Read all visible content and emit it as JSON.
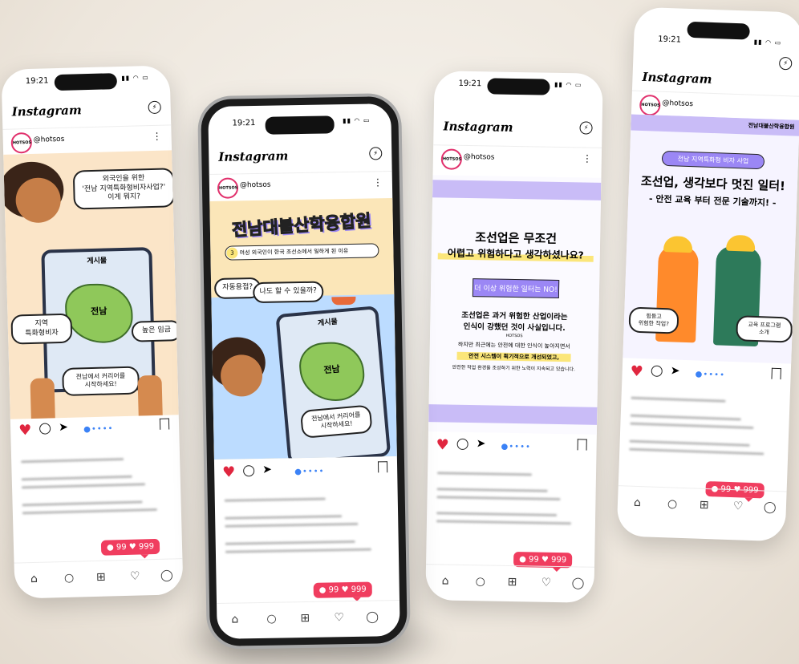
{
  "phones": [
    {
      "time": "19:21",
      "app": "Instagram",
      "handle": "@hotsos",
      "avatar": "HOTSOS",
      "post": {
        "bubble": "외국인을 위한\n'전남 지역특화형비자사업?'\n이게 뭐지?",
        "map_label": "전남",
        "screen_title": "게시물",
        "left_tag": "지역\n특화형비자",
        "right_tag": "높은 임금",
        "bottom_note": "전남에서 커리어를\n시작하세요!"
      },
      "badge": "● 99 ♥ 999"
    },
    {
      "time": "19:21",
      "app": "Instagram",
      "handle": "@hotsos",
      "avatar": "HOTSOS",
      "post": {
        "title": "전남대불산학융합원",
        "subtitle_num": "3",
        "subtitle": "여성 외국인이 한국 조선소에서 일하게 된 이유",
        "thought1": "자동용접?",
        "thought2": "나도 할 수 있을까?",
        "screen_title": "게시물",
        "map_label": "전남",
        "bottom_note": "전남에서 커리어를\n시작하세요!"
      },
      "badge": "● 99 ♥ 999"
    },
    {
      "time": "19:21",
      "app": "Instagram",
      "handle": "@hotsos",
      "avatar": "HOTSOS",
      "post": {
        "headline1": "조선업은 무조건",
        "headline2": "어렵고 위험하다고 생각하셨나요?",
        "pill": "더 이상 위험한 일터는 NO!",
        "body1": "조선업은 과거 위험한 산업이라는",
        "body2": "인식이 강했던 것이 사실입니다.",
        "mini": "HOTSOS",
        "body3": "하지만 최근에는 안전에 대한 인식이 높아지면서",
        "body4": "안전 시스템이 획기적으로 개선되었고,",
        "body5": "안전한 작업 환경을 조성하기 위한 노력이 지속되고 있습니다."
      },
      "badge": "● 99 ♥ 999"
    },
    {
      "time": "19:21",
      "app": "Instagram",
      "handle": "@hotsos",
      "avatar": "HOTSOS",
      "post": {
        "org": "전남대불산학융합원",
        "pill": "전남 지역특화형 비자 사업",
        "headline1": "조선업, 생각보다 멋진 일터!",
        "headline2": "- 안전 교육 부터 전문 기술까지! -",
        "bubble_left": "힘들고\n위험한 작업?",
        "bubble_right": "교육 프로그램\n소개"
      },
      "badge": "● 99 ♥ 999"
    }
  ],
  "colors": {
    "accent": "#f03d5f",
    "purple": "#9b87f5",
    "lavender": "#d9d0fb",
    "yellow": "#fbe67a",
    "peach": "#fbe5c8",
    "sky": "#cfe6ff",
    "heart": "#e0263f"
  },
  "icons": [
    "heart-icon",
    "comment-icon",
    "share-icon",
    "bookmark-icon",
    "home-icon",
    "search-icon",
    "add-icon",
    "activity-icon",
    "profile-icon",
    "messenger-icon",
    "more-icon"
  ]
}
